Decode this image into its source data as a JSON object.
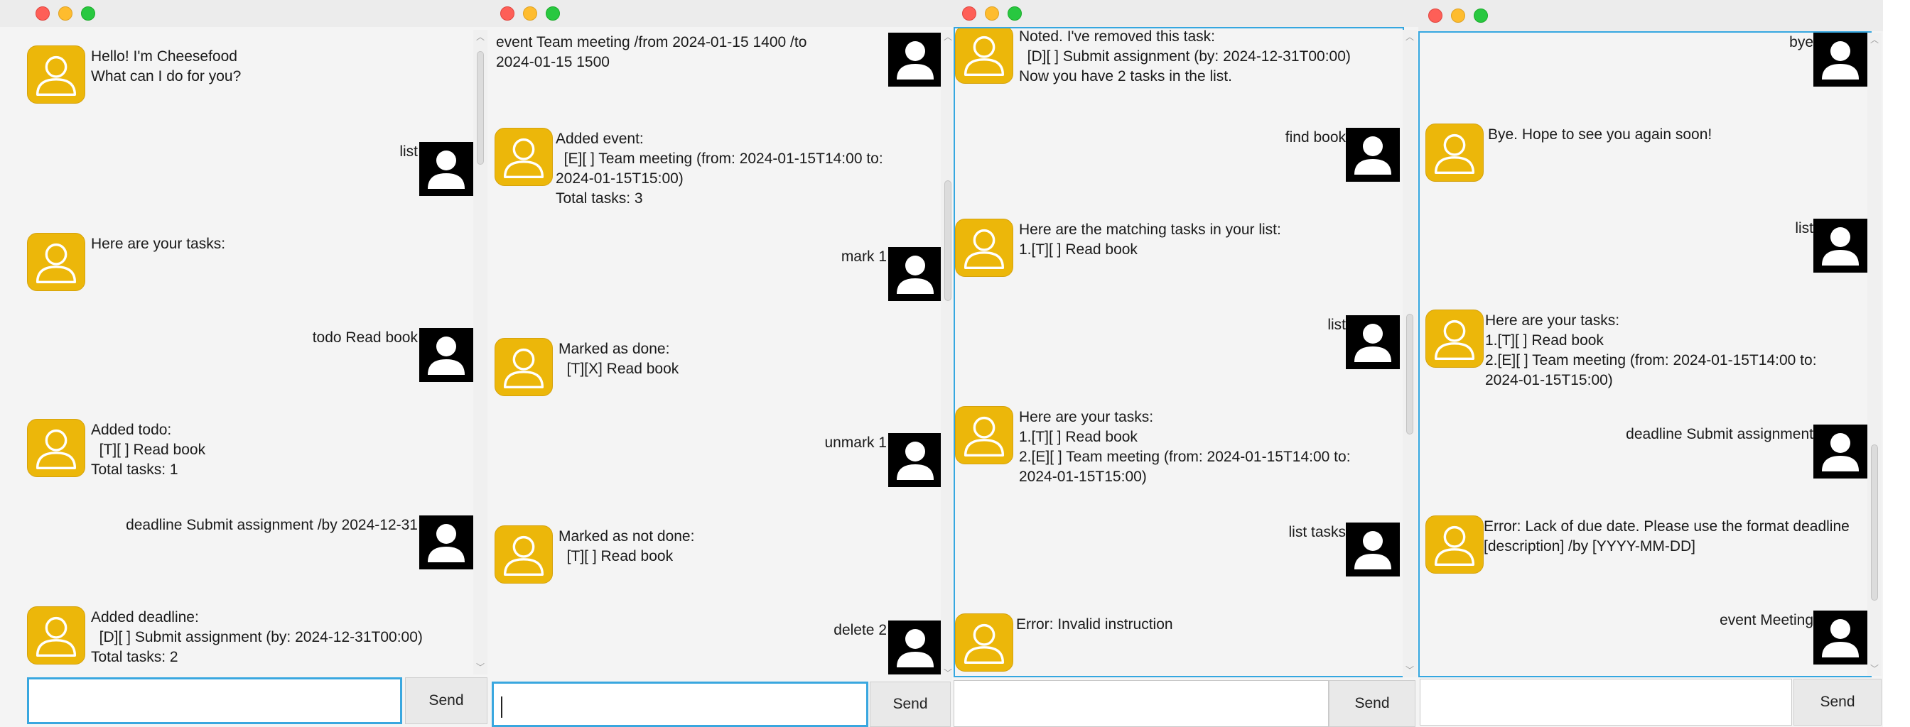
{
  "colors": {
    "bot_avatar": "#ecb70a",
    "user_avatar": "#000000",
    "focus": "#39a7df"
  },
  "icons": {
    "bot": "person-outline-icon",
    "user": "person-silhouette-icon"
  },
  "window1": {
    "bot_greeting": "Hello! I'm Cheesefood\nWhat can I do for you?",
    "user_list": "list",
    "bot_tasks_header": "Here are your tasks:",
    "user_todo": "todo Read book",
    "bot_added_todo": "Added todo:\n  [T][ ] Read book\nTotal tasks: 1",
    "user_deadline": "deadline Submit assignment /by 2024-12-31",
    "bot_added_deadline": "Added deadline:\n  [D][ ] Submit assignment (by: 2024-12-31T00:00)\nTotal tasks: 2",
    "input_value": "",
    "send_label": "Send"
  },
  "window2": {
    "user_event": "event Team meeting /from 2024-01-15 1400 /to\n2024-01-15 1500",
    "bot_added_event": "Added event:\n  [E][ ] Team meeting (from: 2024-01-15T14:00 to:\n2024-01-15T15:00)\nTotal tasks: 3",
    "user_mark": "mark 1",
    "bot_marked": "Marked as done:\n  [T][X] Read book",
    "user_unmark": "unmark 1",
    "bot_unmarked": "Marked as not done:\n  [T][ ] Read book",
    "user_delete": "delete 2",
    "input_value": "",
    "send_label": "Send"
  },
  "window3": {
    "bot_removed": "Noted. I've removed this task:\n  [D][ ] Submit assignment (by: 2024-12-31T00:00)\nNow you have 2 tasks in the list.",
    "user_find": "find book",
    "bot_matching": "Here are the matching tasks in your list:\n1.[T][ ] Read book",
    "user_list": "list",
    "bot_tasks": "Here are your tasks:\n1.[T][ ] Read book\n2.[E][ ] Team meeting (from: 2024-01-15T14:00 to:\n2024-01-15T15:00)",
    "user_list_tasks": "list tasks",
    "bot_error": "Error: Invalid instruction",
    "input_value": "",
    "send_label": "Send"
  },
  "window4": {
    "user_bye": "bye",
    "bot_bye": "Bye. Hope to see you again soon!",
    "user_list": "list",
    "bot_tasks": "Here are your tasks:\n1.[T][ ] Read book\n2.[E][ ] Team meeting (from: 2024-01-15T14:00 to:\n2024-01-15T15:00)",
    "user_deadline": "deadline Submit assignment",
    "bot_error": "Error: Lack of due date. Please use the format deadline\n[description] /by [YYYY-MM-DD]",
    "user_event": "event Meeting",
    "input_value": "",
    "send_label": "Send"
  }
}
